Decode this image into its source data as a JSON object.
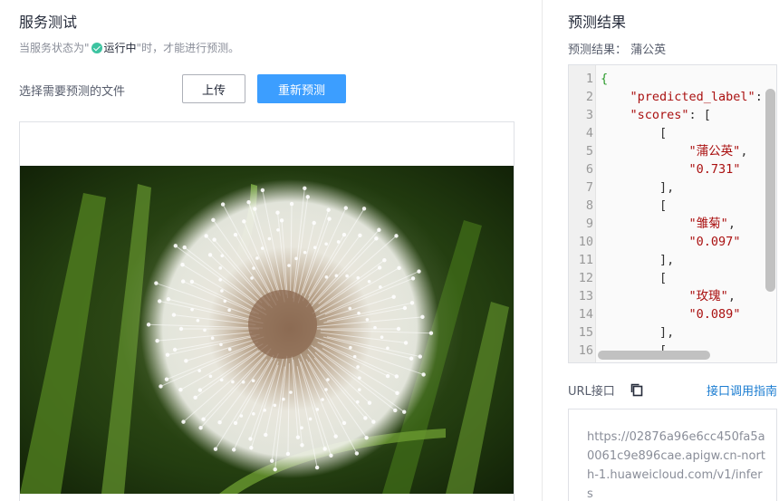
{
  "left": {
    "title": "服务测试",
    "hint_prefix": "当服务状态为\"",
    "hint_status": "运行中",
    "hint_suffix": "\"时，才能进行预测。",
    "select_label": "选择需要预测的文件",
    "upload_button": "上传",
    "repredict_button": "重新预测"
  },
  "right": {
    "title": "预测结果",
    "result_label": "预测结果：",
    "result_value": "蒲公英",
    "code_lines": [
      "{",
      "    \"predicted_label\": ",
      "    \"scores\": [",
      "        [",
      "            \"蒲公英\",",
      "            \"0.731\"",
      "        ],",
      "        [",
      "            \"雏菊\",",
      "            \"0.097\"",
      "        ],",
      "        [",
      "            \"玫瑰\",",
      "            \"0.089\"",
      "        ],",
      "        ["
    ],
    "url_label": "URL接口",
    "guide_link": "接口调用指南",
    "url_value": "https://02876a96e6cc450fa5a0061c9e896cae.apigw.cn-north-1.huaweicloud.com/v1/infers"
  },
  "colors": {
    "primary": "#3c9eff",
    "success": "#3cc3a0",
    "link": "#1a7cd1"
  }
}
